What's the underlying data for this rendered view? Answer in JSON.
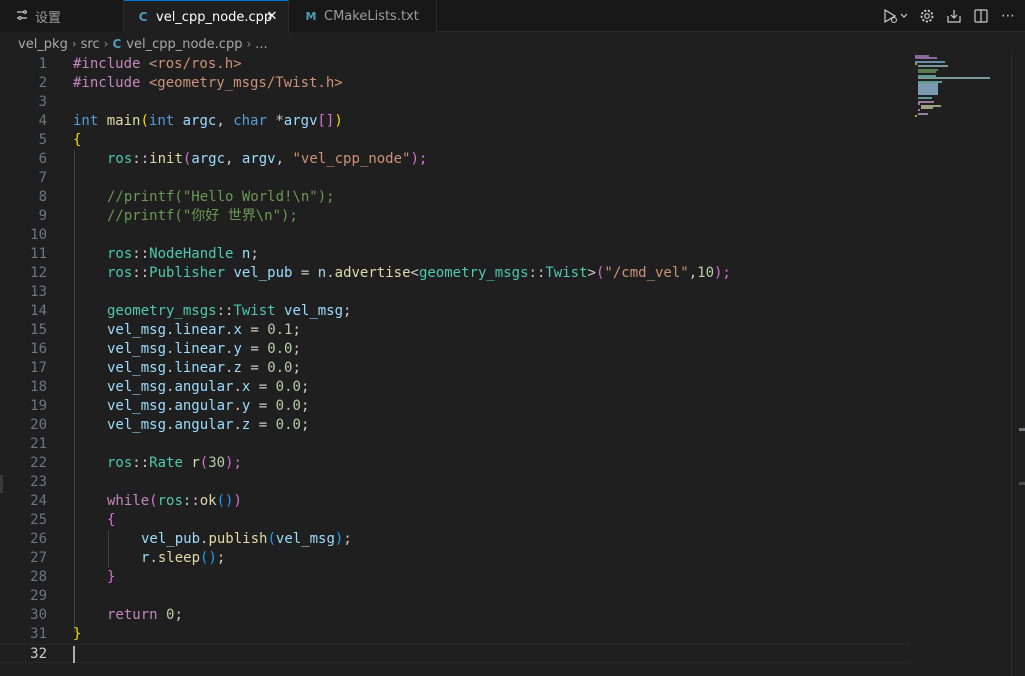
{
  "tabs": [
    {
      "label": "设置",
      "icon": "settings-sliders-icon"
    },
    {
      "label": "vel_cpp_node.cpp",
      "icon": "cpp-file-icon",
      "active": true
    },
    {
      "label": "CMakeLists.txt",
      "icon": "cmake-file-icon"
    }
  ],
  "breadcrumb": {
    "folder1": "vel_pkg",
    "folder2": "src",
    "file": "vel_cpp_node.cpp",
    "more": "..."
  },
  "line_numbers": [
    "1",
    "2",
    "3",
    "4",
    "5",
    "6",
    "7",
    "8",
    "9",
    "10",
    "11",
    "12",
    "13",
    "14",
    "15",
    "16",
    "17",
    "18",
    "19",
    "20",
    "21",
    "22",
    "23",
    "24",
    "25",
    "26",
    "27",
    "28",
    "29",
    "30",
    "31",
    "32"
  ],
  "colors": {
    "accent": "#0078d4",
    "background": "#1f1f1f",
    "keyword": "#569cd6",
    "string": "#ce9178",
    "comment": "#6a9955",
    "type": "#4ec9b0"
  },
  "code": {
    "l1": [
      "#include ",
      "<ros/ros.h>"
    ],
    "l2": [
      "#include ",
      "<geometry_msgs/Twist.h>"
    ],
    "l4": [
      "int",
      " ",
      "main",
      "(",
      "int",
      " ",
      "argc",
      ", ",
      "char",
      " *",
      "argv",
      "[]",
      ")"
    ],
    "l5": [
      "{"
    ],
    "l6": [
      "ros",
      "::",
      "init",
      "(",
      "argc",
      ", ",
      "argv",
      ", ",
      "\"vel_cpp_node\"",
      ");"
    ],
    "l8": [
      "//printf(\"Hello World!\\n\");"
    ],
    "l9": [
      "//printf(\"你好 世界\\n\");"
    ],
    "l11": [
      "ros",
      "::",
      "NodeHandle",
      " ",
      "n",
      ";"
    ],
    "l12": [
      "ros",
      "::",
      "Publisher",
      " ",
      "vel_pub",
      " = ",
      "n",
      ".",
      "advertise",
      "<",
      "geometry_msgs",
      "::",
      "Twist",
      ">",
      "(",
      "\"/cmd_vel\"",
      ",",
      "10",
      ");"
    ],
    "l14": [
      "geometry_msgs",
      "::",
      "Twist",
      " ",
      "vel_msg",
      ";"
    ],
    "l15": [
      "vel_msg",
      ".",
      "linear",
      ".",
      "x",
      " = ",
      "0.1",
      ";"
    ],
    "l16": [
      "vel_msg",
      ".",
      "linear",
      ".",
      "y",
      " = ",
      "0.0",
      ";"
    ],
    "l17": [
      "vel_msg",
      ".",
      "linear",
      ".",
      "z",
      " = ",
      "0.0",
      ";"
    ],
    "l18": [
      "vel_msg",
      ".",
      "angular",
      ".",
      "x",
      " = ",
      "0.0",
      ";"
    ],
    "l19": [
      "vel_msg",
      ".",
      "angular",
      ".",
      "y",
      " = ",
      "0.0",
      ";"
    ],
    "l20": [
      "vel_msg",
      ".",
      "angular",
      ".",
      "z",
      " = ",
      "0.0",
      ";"
    ],
    "l22": [
      "ros",
      "::",
      "Rate",
      " ",
      "r",
      "(",
      "30",
      ");"
    ],
    "l24": [
      "while",
      "(",
      "ros",
      "::",
      "ok",
      "(",
      ")",
      ")"
    ],
    "l25": [
      "{"
    ],
    "l26": [
      "vel_pub",
      ".",
      "publish",
      "(",
      "vel_msg",
      ")",
      ";"
    ],
    "l27": [
      "r",
      ".",
      "sleep",
      "(",
      ")",
      ";"
    ],
    "l28": [
      "}"
    ],
    "l30": [
      "return",
      " ",
      "0",
      ";"
    ],
    "l31": [
      "}"
    ]
  }
}
